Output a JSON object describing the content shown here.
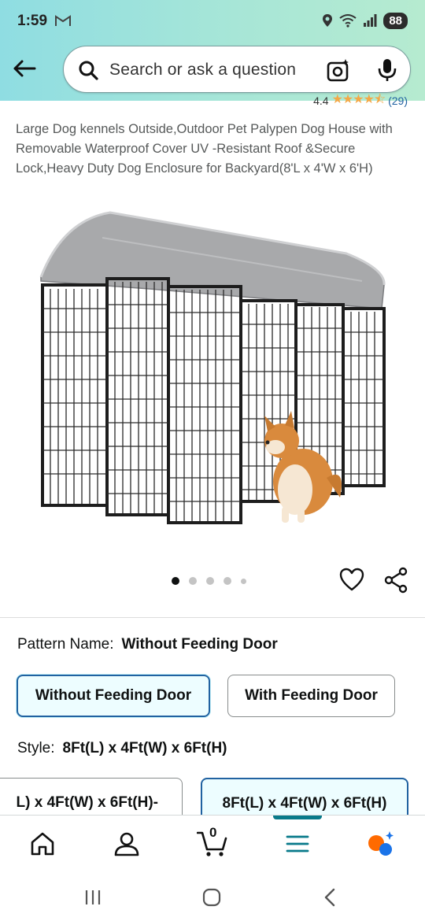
{
  "status_bar": {
    "time": "1:59",
    "battery": "88"
  },
  "search": {
    "placeholder": "Search or ask a question"
  },
  "rating": {
    "value": "4.4",
    "stars": "★★★★⯪",
    "count": "(29)"
  },
  "product": {
    "title": "Large Dog kennels Outside,Outdoor Pet Palypen Dog House with Removable Waterproof Cover UV -Resistant Roof &Secure Lock,Heavy Duty Dog Enclosure for Backyard(8'L x 4'W x 6'H)"
  },
  "carousel": {
    "count": 5,
    "active_index": 0
  },
  "pattern": {
    "label": "Pattern Name:",
    "selected": "Without Feeding Door",
    "options": [
      "Without Feeding Door",
      "With Feeding Door"
    ]
  },
  "style": {
    "label": "Style:",
    "selected": "8Ft(L) x 4Ft(W) x 6Ft(H)",
    "options": [
      "L) x 4Ft(W) x 6Ft(H)-",
      "8Ft(L) x 4Ft(W) x 6Ft(H)"
    ]
  },
  "bottom_nav": {
    "cart_count": "0",
    "active": "menu"
  },
  "colors": {
    "accent": "#2162a1",
    "selected_bg": "#edfdff",
    "nav_indicator": "#087a8a",
    "star": "#f3a847"
  }
}
